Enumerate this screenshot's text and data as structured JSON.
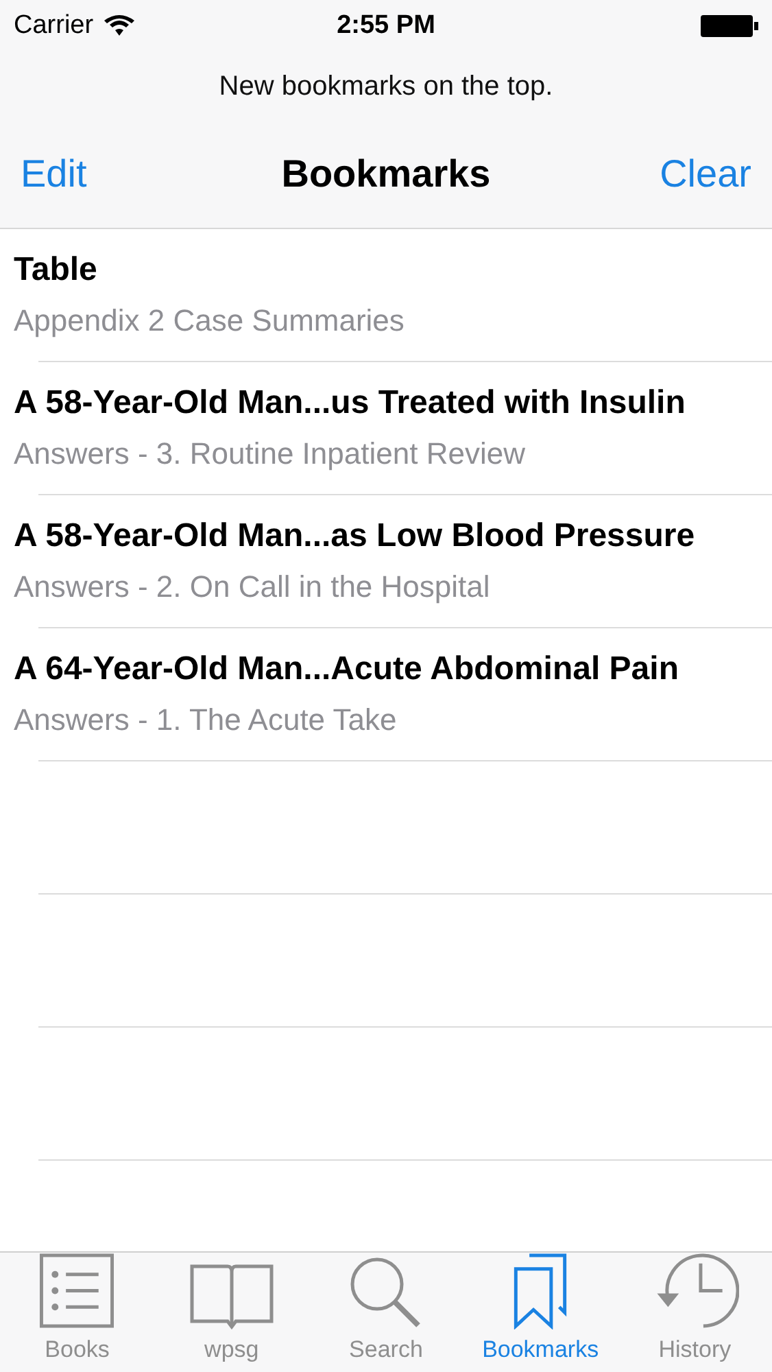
{
  "status_bar": {
    "carrier": "Carrier",
    "time": "2:55 PM"
  },
  "header_note": "New bookmarks on the top.",
  "nav": {
    "left": "Edit",
    "title": "Bookmarks",
    "right": "Clear"
  },
  "bookmarks": [
    {
      "title": "Table",
      "subtitle": "Appendix 2 Case Summaries"
    },
    {
      "title": "A 58-Year-Old Man...us Treated with Insulin",
      "subtitle": "Answers - 3. Routine Inpatient Review"
    },
    {
      "title": "A 58-Year-Old Man...as Low Blood Pressure",
      "subtitle": "Answers - 2. On Call in the Hospital"
    },
    {
      "title": "A 64-Year-Old Man...Acute Abdominal Pain",
      "subtitle": "Answers - 1. The Acute Take"
    }
  ],
  "tabs": [
    {
      "label": "Books",
      "kind": "list",
      "selected": false
    },
    {
      "label": "wpsg",
      "kind": "book",
      "selected": false
    },
    {
      "label": "Search",
      "kind": "search",
      "selected": false
    },
    {
      "label": "Bookmarks",
      "kind": "bookmarks",
      "selected": true
    },
    {
      "label": "History",
      "kind": "history",
      "selected": false
    }
  ]
}
